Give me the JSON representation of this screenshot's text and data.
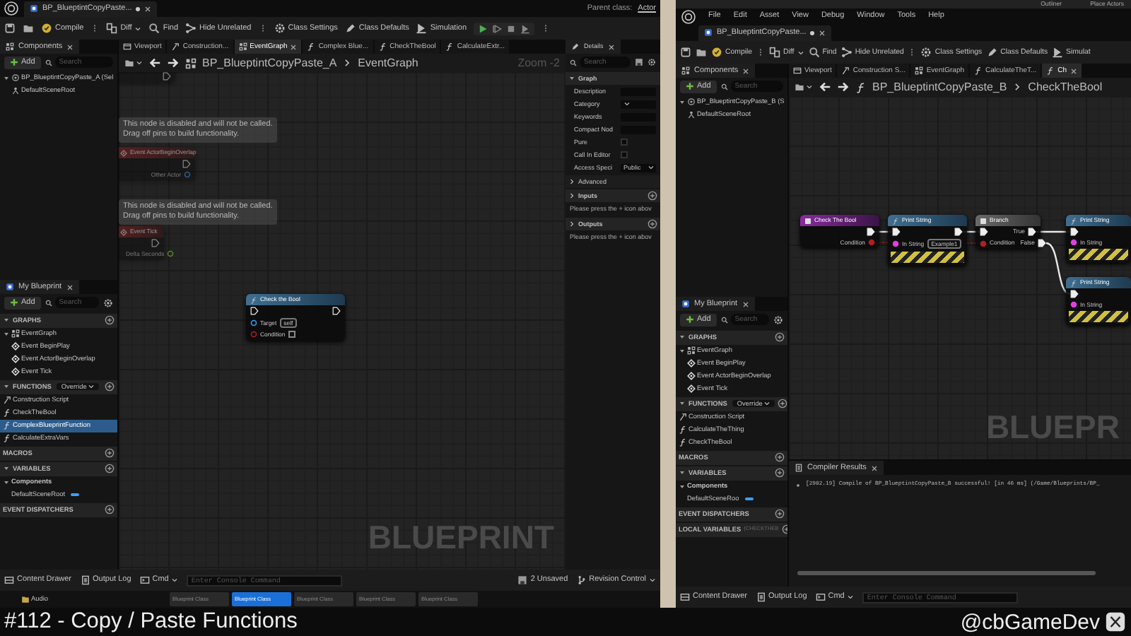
{
  "left_window": {
    "tab_title": "BP_BlueptintCopyPaste...",
    "unsaved": true,
    "parent_class_label": "Parent class:",
    "parent_class": "Actor",
    "toolbar": [
      "Compile",
      "Diff",
      "Find",
      "Hide Unrelated",
      "Class Settings",
      "Class Defaults",
      "Simulation"
    ],
    "components": {
      "title": "Components",
      "add": "Add",
      "search_placeholder": "Search",
      "items": [
        {
          "label": "BP_BlueptintCopyPaste_A (Sel",
          "kind": "blueprint",
          "selected": false,
          "children": [
            {
              "label": "DefaultSceneRoot",
              "kind": "scene",
              "selected": false
            }
          ]
        }
      ]
    },
    "graph_tabs": [
      {
        "label": "Viewport",
        "kind": "viewport",
        "selected": false
      },
      {
        "label": "Construction...",
        "kind": "construction",
        "selected": false
      },
      {
        "label": "EventGraph",
        "kind": "graph",
        "selected": true
      },
      {
        "label": "Complex Blue...",
        "kind": "function",
        "selected": false
      },
      {
        "label": "CheckTheBool",
        "kind": "function",
        "selected": false
      },
      {
        "label": "CalculateExtr...",
        "kind": "function",
        "selected": false
      }
    ],
    "breadcrumb": {
      "blueprint": "BP_BlueptintCopyPaste_A",
      "graph": "EventGraph",
      "kind": "graph"
    },
    "zoom": "Zoom -2",
    "nodes": [
      {
        "kind": "event",
        "disabled": true,
        "rows": [
          {
            "right": {
              "kind": "exec"
            }
          }
        ]
      },
      {
        "kind": "event",
        "disabled": true,
        "comment": "This node is disabled and will not be called.\nDrag off pins to build functionality.",
        "title": "Event ActorBeginOverlap",
        "rows": [
          {
            "right": {
              "kind": "exec"
            }
          },
          {
            "right": {
              "kind": "object",
              "label": "Other Actor"
            }
          }
        ]
      },
      {
        "kind": "event",
        "disabled": true,
        "comment": "This node is disabled and will not be called.\nDrag off pins to build functionality.",
        "title": "Event Tick",
        "rows": [
          {
            "right": {
              "kind": "exec"
            }
          },
          {
            "right": {
              "kind": "float",
              "label": "Delta Seconds"
            }
          }
        ]
      },
      {
        "kind": "function",
        "disabled": false,
        "title": "Check the Bool",
        "rows": [
          {
            "left": {
              "kind": "exec"
            },
            "right": {
              "kind": "exec"
            }
          },
          {
            "left": {
              "kind": "object",
              "label": "Target",
              "value": "self"
            }
          },
          {
            "left": {
              "kind": "bool",
              "label": "Condition",
              "checked": false
            }
          }
        ]
      }
    ],
    "watermark": "BLUEPRINT",
    "my_blueprint": {
      "title": "My Blueprint",
      "add": "Add",
      "search_placeholder": "Search",
      "sections": [
        {
          "label": "GRAPHS",
          "items": [
            {
              "label": "EventGraph",
              "kind": "graph",
              "selected": false,
              "children": [
                {
                  "label": "Event BeginPlay",
                  "kind": "event",
                  "selected": false
                },
                {
                  "label": "Event ActorBeginOverlap",
                  "kind": "event",
                  "selected": false
                },
                {
                  "label": "Event Tick",
                  "kind": "event",
                  "selected": false
                }
              ]
            }
          ]
        },
        {
          "label": "FUNCTIONS",
          "override": "Override",
          "items": [
            {
              "label": "Construction Script",
              "kind": "construction",
              "selected": false
            },
            {
              "label": "CheckTheBool",
              "kind": "function",
              "selected": false
            },
            {
              "label": "ComplexBlueprintFunction",
              "kind": "function",
              "selected": true
            },
            {
              "label": "CalculateExtraVars",
              "kind": "function",
              "selected": false
            }
          ]
        },
        {
          "label": "MACROS"
        },
        {
          "label": "VARIABLES",
          "items": [
            {
              "label": "Components",
              "kind": "category",
              "selected": false,
              "children": [
                {
                  "label": "DefaultSceneRoot",
                  "kind": "variable",
                  "selected": false
                }
              ]
            }
          ]
        },
        {
          "label": "EVENT DISPATCHERS"
        }
      ]
    },
    "details": {
      "title": "Details",
      "search_placeholder": "Search",
      "sections": [
        {
          "label": "Graph",
          "rows": [
            {
              "label": "Description",
              "kind": "text"
            },
            {
              "label": "Category",
              "kind": "combo"
            },
            {
              "label": "Keywords",
              "kind": "text"
            },
            {
              "label": "Compact Nod",
              "kind": "text"
            },
            {
              "label": "Pure",
              "kind": "checkbox",
              "checked": false
            },
            {
              "label": "Call In Editor",
              "kind": "checkbox",
              "checked": false
            },
            {
              "label": "Access Speci",
              "kind": "combo",
              "value": "Public"
            }
          ]
        },
        {
          "label": "Advanced"
        },
        {
          "label": "Inputs",
          "hint": "Please press the + icon abov"
        },
        {
          "label": "Outputs",
          "hint": "Please press the + icon abov"
        }
      ]
    },
    "bottom_bar": {
      "content_drawer": "Content Drawer",
      "output_log": "Output Log",
      "cmd": "Cmd",
      "console_placeholder": "Enter Console Command",
      "unsaved": "2 Unsaved",
      "revision_control": "Revision Control"
    },
    "content_folders": [
      "Audio"
    ],
    "content_tiles": [
      {
        "label": "Blueprint Class",
        "selected": false
      },
      {
        "label": "Blueprint Class",
        "selected": true
      },
      {
        "label": "Blueprint Class",
        "selected": false
      },
      {
        "label": "Blueprint Class",
        "selected": false
      },
      {
        "label": "Blueprint Class",
        "selected": false
      }
    ]
  },
  "right_window": {
    "background_tabs": [
      "Outliner",
      "Place Actors"
    ],
    "menu": [
      "File",
      "Edit",
      "Asset",
      "View",
      "Debug",
      "Window",
      "Tools",
      "Help"
    ],
    "tab_title": "BP_BlueptintCopyPaste...",
    "unsaved": true,
    "toolbar": [
      "Compile",
      "Diff",
      "Find",
      "Hide Unrelated",
      "Class Settings",
      "Class Defaults",
      "Simulat"
    ],
    "components": {
      "title": "Components",
      "add": "Add",
      "search_placeholder": "Search",
      "items": [
        {
          "label": "BP_BlueptintCopyPaste_B (S",
          "kind": "blueprint",
          "selected": false,
          "children": [
            {
              "label": "DefaultSceneRoot",
              "kind": "scene",
              "selected": false
            }
          ]
        }
      ]
    },
    "graph_tabs": [
      {
        "label": "Viewport",
        "kind": "viewport",
        "selected": false
      },
      {
        "label": "Construction S...",
        "kind": "construction",
        "selected": false
      },
      {
        "label": "EventGraph",
        "kind": "graph",
        "selected": false
      },
      {
        "label": "CalculateTheT...",
        "kind": "function",
        "selected": false
      },
      {
        "label": "Ch",
        "kind": "function",
        "selected": true
      }
    ],
    "breadcrumb": {
      "blueprint": "BP_BlueptintCopyPaste_B",
      "graph": "CheckTheBool",
      "kind": "function"
    },
    "nodes": [
      {
        "kind": "entry",
        "disabled": false,
        "title": "Check The Bool",
        "rows": [
          {
            "right": {
              "kind": "exec"
            }
          },
          {
            "right": {
              "kind": "bool",
              "label": "Condition"
            }
          }
        ]
      },
      {
        "kind": "function",
        "disabled": false,
        "title": "Print String",
        "dev_only": true,
        "rows": [
          {
            "left": {
              "kind": "exec"
            },
            "right": {
              "kind": "exec"
            }
          },
          {
            "left": {
              "kind": "string",
              "label": "In String",
              "value": "Example1"
            }
          }
        ]
      },
      {
        "kind": "branch",
        "disabled": false,
        "title": "Branch",
        "rows": [
          {
            "left": {
              "kind": "exec"
            },
            "right": {
              "kind": "exec",
              "label": "True"
            }
          },
          {
            "left": {
              "kind": "bool",
              "label": "Condition"
            },
            "right": {
              "kind": "exec",
              "label": "False"
            }
          }
        ]
      },
      {
        "kind": "function",
        "disabled": false,
        "title": "Print String",
        "dev_only": true,
        "rows": [
          {
            "left": {
              "kind": "exec"
            }
          },
          {
            "left": {
              "kind": "string",
              "label": "In String"
            }
          }
        ]
      },
      {
        "kind": "function",
        "disabled": false,
        "title": "Print String",
        "dev_only": true,
        "rows": [
          {
            "left": {
              "kind": "exec"
            }
          },
          {
            "left": {
              "kind": "string",
              "label": "In String"
            }
          }
        ]
      }
    ],
    "watermark": "BLUEPR",
    "my_blueprint": {
      "title": "My Blueprint",
      "add": "Add",
      "search_placeholder": "Search",
      "sections": [
        {
          "label": "GRAPHS",
          "items": [
            {
              "label": "EventGraph",
              "kind": "graph",
              "selected": false,
              "children": [
                {
                  "label": "Event BeginPlay",
                  "kind": "event",
                  "selected": false
                },
                {
                  "label": "Event ActorBeginOverlap",
                  "kind": "event",
                  "selected": false
                },
                {
                  "label": "Event Tick",
                  "kind": "event",
                  "selected": false
                }
              ]
            }
          ]
        },
        {
          "label": "FUNCTIONS",
          "override": "Override",
          "items": [
            {
              "label": "Construction Script",
              "kind": "construction",
              "selected": false
            },
            {
              "label": "CalculateTheThing",
              "kind": "function",
              "selected": false
            },
            {
              "label": "CheckTheBool",
              "kind": "function",
              "selected": false
            }
          ]
        },
        {
          "label": "MACROS"
        },
        {
          "label": "VARIABLES",
          "items": [
            {
              "label": "Components",
              "kind": "category",
              "selected": false,
              "children": [
                {
                  "label": "DefaultSceneRoo",
                  "kind": "variable",
                  "selected": false
                }
              ]
            }
          ]
        },
        {
          "label": "EVENT DISPATCHERS"
        },
        {
          "label": "LOCAL VARIABLES",
          "note": "(CHECKTHEB"
        }
      ]
    },
    "compiler_results": {
      "title": "Compiler Results",
      "messages": [
        "[2902.19] Compile of BP_BlueptintCopyPaste_B successful! [in 46 ms] (/Game/Blueprints/BP_"
      ]
    },
    "bottom_bar": {
      "content_drawer": "Content Drawer",
      "output_log": "Output Log",
      "cmd": "Cmd",
      "console_placeholder": "Enter Console Command"
    }
  },
  "caption": {
    "title": "#112 - Copy / Paste Functions",
    "handle": "@cbGameDev"
  }
}
